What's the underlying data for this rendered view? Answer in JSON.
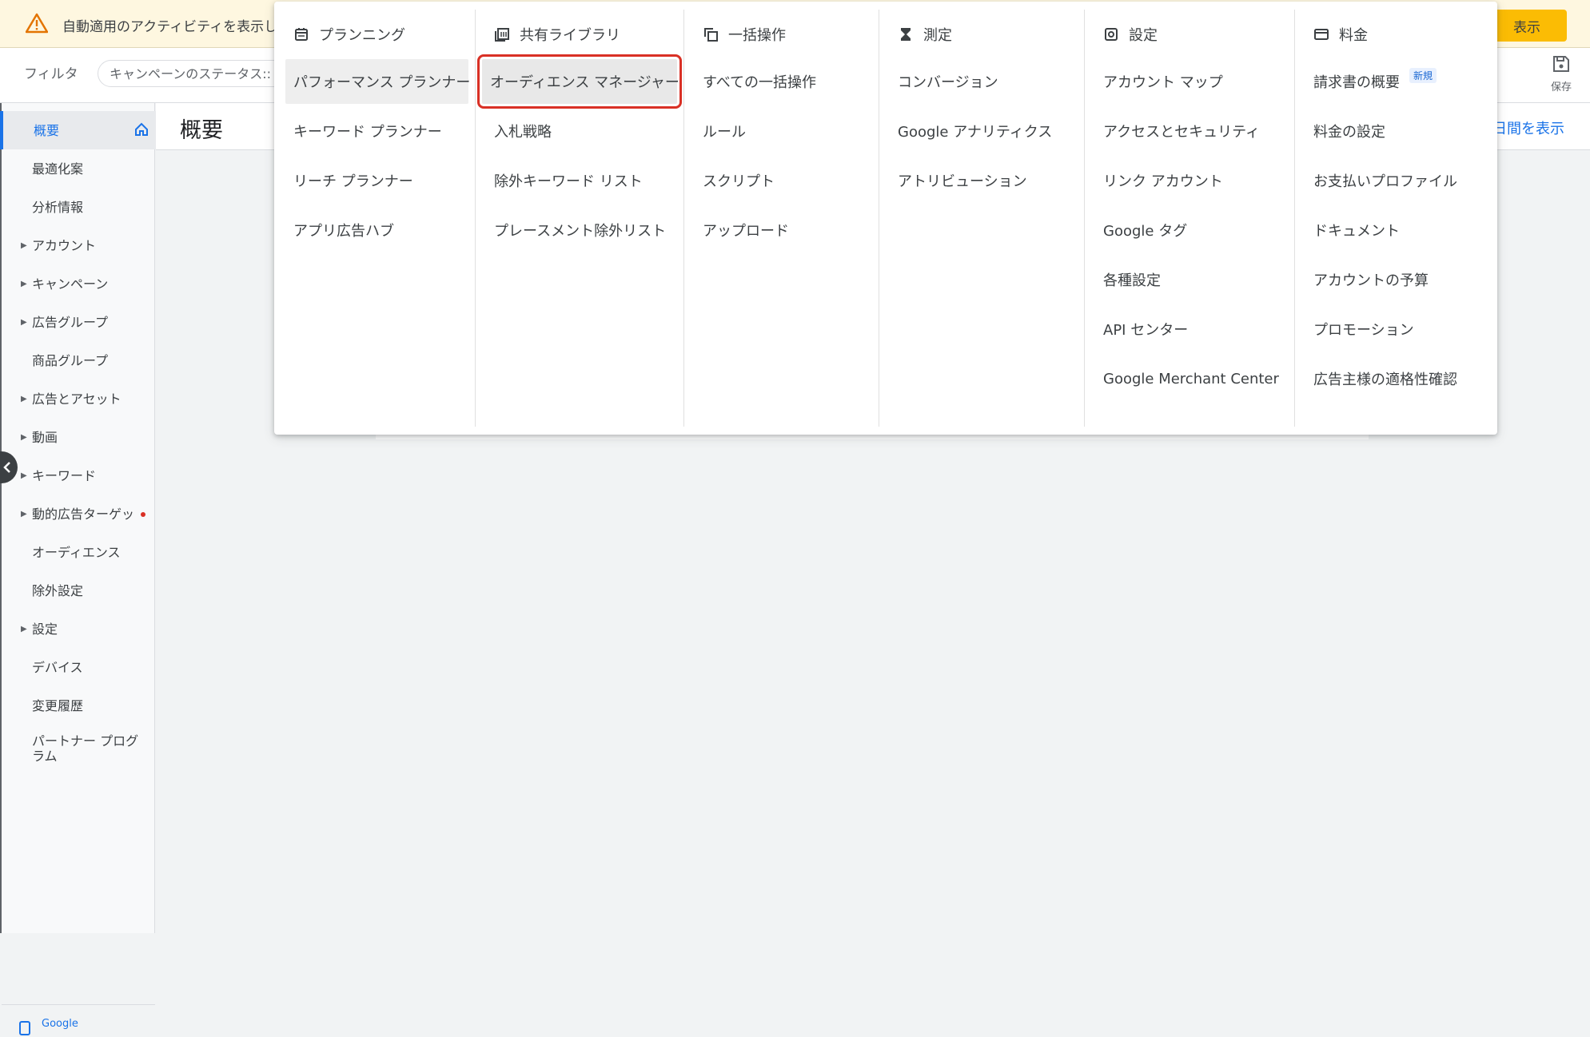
{
  "banner": {
    "text": "自動適用のアクティビティを表示しま",
    "show_button": "表示"
  },
  "filter": {
    "label": "フィルタ",
    "chip_text": "キャンペーンのステータス:: 有",
    "save_label": "保存"
  },
  "page": {
    "title": "概要",
    "date_link": "日間を表示"
  },
  "sidebar": {
    "items": [
      {
        "label": "概要",
        "active": true,
        "arrow": false
      },
      {
        "label": "最適化案",
        "arrow": false
      },
      {
        "label": "分析情報",
        "arrow": false
      },
      {
        "label": "アカウント",
        "arrow": true
      },
      {
        "label": "キャンペーン",
        "arrow": true
      },
      {
        "label": "広告グループ",
        "arrow": true
      },
      {
        "label": "商品グループ",
        "arrow": false
      },
      {
        "label": "広告とアセット",
        "arrow": true
      },
      {
        "label": "動画",
        "arrow": true
      },
      {
        "label": "キーワード",
        "arrow": true
      },
      {
        "label": "動的広告ターゲッ",
        "arrow": true,
        "dot": true
      },
      {
        "label": "オーディエンス",
        "arrow": false
      },
      {
        "label": "除外設定",
        "arrow": false
      },
      {
        "label": "設定",
        "arrow": true
      },
      {
        "label": "デバイス",
        "arrow": false
      },
      {
        "label": "変更履歴",
        "arrow": false
      },
      {
        "label": "パートナー プログラム",
        "arrow": false
      }
    ],
    "app_promo": "Google"
  },
  "menu": {
    "columns": [
      {
        "heading": "プランニング",
        "icon": "calendar-icon",
        "items": [
          "パフォーマンス プランナー",
          "キーワード プランナー",
          "リーチ プランナー",
          "アプリ広告ハブ"
        ]
      },
      {
        "heading": "共有ライブラリ",
        "icon": "library-icon",
        "items": [
          "オーディエンス マネージャー",
          "入札戦略",
          "除外キーワード リスト",
          "プレースメント除外リスト"
        ]
      },
      {
        "heading": "一括操作",
        "icon": "copy-icon",
        "items": [
          "すべての一括操作",
          "ルール",
          "スクリプト",
          "アップロード"
        ]
      },
      {
        "heading": "測定",
        "icon": "hourglass-icon",
        "items": [
          "コンバージョン",
          "Google アナリティクス",
          "アトリビューション"
        ]
      },
      {
        "heading": "設定",
        "icon": "settings-icon",
        "items": [
          "アカウント マップ",
          "アクセスとセキュリティ",
          "リンク アカウント",
          "Google タグ",
          "各種設定",
          "API センター",
          "Google Merchant Center"
        ]
      },
      {
        "heading": "料金",
        "icon": "card-icon",
        "items": [
          "請求書の概要",
          "料金の設定",
          "お支払いプロファイル",
          "ドキュメント",
          "アカウントの予算",
          "プロモーション",
          "広告主様の適格性確認"
        ],
        "badge": "新規"
      }
    ]
  },
  "colors": {
    "accent": "#1a73e8",
    "warning": "#fbbc04",
    "highlight": "#d93025"
  }
}
